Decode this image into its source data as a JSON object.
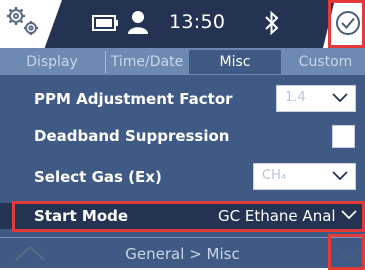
{
  "status": {
    "time": "13:50",
    "icons": [
      "gears-icon",
      "battery-icon",
      "user-icon",
      "bluetooth-icon",
      "check-circle-icon"
    ]
  },
  "tabs": [
    {
      "label": "Display",
      "active": false
    },
    {
      "label": "Time/Date",
      "active": false
    },
    {
      "label": "Misc",
      "active": true
    },
    {
      "label": "Custom",
      "active": false
    }
  ],
  "settings": {
    "ppm_label": "PPM Adjustment Factor",
    "ppm_value": "1.4",
    "deadband_label": "Deadband Suppression",
    "deadband_checked": false,
    "gas_label": "Select Gas (Ex)",
    "gas_value": "CH₄",
    "start_mode_label": "Start Mode",
    "start_mode_value": "GC Ethane Anal"
  },
  "footer": {
    "breadcrumb": "General > Misc"
  },
  "colors": {
    "panel": "#3f5a84",
    "dark_bar": "#243352",
    "tab_strip": "#6d8ab2",
    "highlight": "#e33a3a"
  }
}
